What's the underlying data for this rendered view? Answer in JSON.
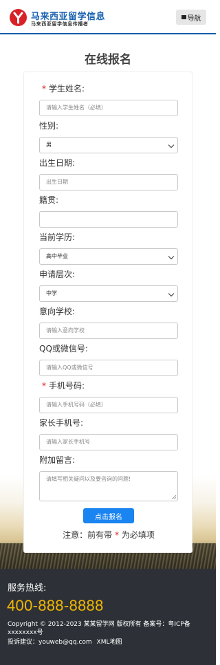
{
  "header": {
    "title": "马来西亚留学信息",
    "subtitle": "马来西亚留学信息传播者",
    "nav_label": "导航"
  },
  "page_title": "在线报名",
  "form": {
    "name": {
      "label": "学生姓名:",
      "placeholder": "请输入学生姓名（必填）",
      "required": true
    },
    "gender": {
      "label": "性别:",
      "value": "男"
    },
    "birth": {
      "label": "出生日期:",
      "placeholder": "出生日期"
    },
    "hometown": {
      "label": "籍贯:",
      "placeholder": ""
    },
    "education": {
      "label": "当前学历:",
      "value": "高中毕业"
    },
    "level": {
      "label": "申请层次:",
      "value": "中学"
    },
    "school": {
      "label": "意向学校:",
      "placeholder": "请输入意向学校"
    },
    "qq": {
      "label": "QQ或微信号:",
      "placeholder": "请输入QQ或微信号"
    },
    "phone": {
      "label": "手机号码:",
      "placeholder": "请输入手机号码（必填）",
      "required": true
    },
    "parent_phone": {
      "label": "家长手机号:",
      "placeholder": "请输入家长手机号"
    },
    "message": {
      "label": "附加留言:",
      "placeholder": "请填写相关疑问以及要咨询的问题!"
    },
    "required_mark": "*",
    "submit_label": "点击报名",
    "note_prefix": "注意：前有带",
    "note_suffix": "为必填项"
  },
  "footer": {
    "hotline_label": "服务热线:",
    "hotline": "400-888-8888",
    "copyright": "Copyright © 2012-2023 某某留学网 版权所有  备案号：粤ICP备xxxxxxxx号",
    "complaint": "投诉建议：youweb@qq.com",
    "sitemap": "XML地图"
  },
  "colors": {
    "brand_blue": "#1861b0",
    "logo_red": "#d92128",
    "button_blue": "#1a84f0",
    "hotline_yellow": "#f2b600",
    "footer_bg": "#2d3137",
    "required_red": "#e02020"
  }
}
